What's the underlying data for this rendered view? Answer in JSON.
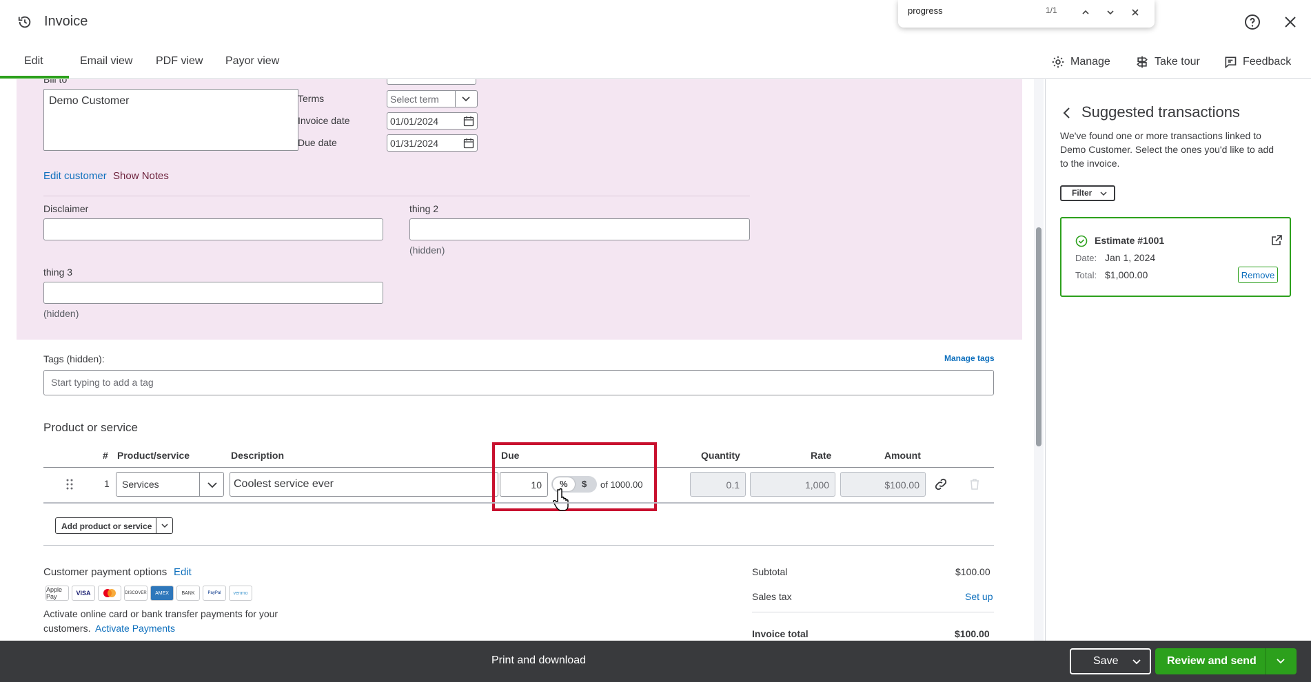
{
  "header": {
    "title": "Invoice"
  },
  "findbar": {
    "query": "progress",
    "count": "1/1"
  },
  "tabs": [
    {
      "label": "Edit"
    },
    {
      "label": "Email view"
    },
    {
      "label": "PDF view"
    },
    {
      "label": "Payor view"
    }
  ],
  "toolbar": {
    "manage": "Manage",
    "tour": "Take tour",
    "feedback": "Feedback"
  },
  "billing": {
    "bill_to_label": "Bill to",
    "customer_text": "Demo Customer",
    "edit_customer": "Edit customer",
    "show_notes": "Show Notes"
  },
  "terms": {
    "terms_label": "Terms",
    "terms_placeholder": "Select term",
    "invoice_date_label": "Invoice date",
    "invoice_date": "01/01/2024",
    "due_date_label": "Due date",
    "due_date": "01/31/2024"
  },
  "custom_fields": {
    "disclaimer_label": "Disclaimer",
    "thing2_label": "thing 2",
    "thing2_note": "(hidden)",
    "thing3_label": "thing 3",
    "thing3_note": "(hidden)"
  },
  "tags": {
    "label": "Tags (hidden):",
    "manage": "Manage tags",
    "placeholder": "Start typing to add a tag"
  },
  "products": {
    "heading": "Product or service",
    "columns": {
      "num": "#",
      "product": "Product/service",
      "description": "Description",
      "due": "Due",
      "quantity": "Quantity",
      "rate": "Rate",
      "amount": "Amount"
    },
    "row": {
      "num": "1",
      "product": "Services",
      "description": "Coolest service ever",
      "due_value": "10",
      "pct": "%",
      "dollar": "$",
      "of_total": "of 1000.00",
      "quantity": "0.1",
      "rate": "1,000",
      "amount": "$100.00"
    },
    "add_button": "Add product or service"
  },
  "payment": {
    "heading": "Customer payment options",
    "edit": "Edit",
    "methods": [
      "Apple Pay",
      "VISA",
      "Mastercard",
      "DISCOVER",
      "AMEX",
      "BANK",
      "PayPal",
      "venmo"
    ],
    "note_line1": "Activate online card or bank transfer payments for your",
    "note_line2": "customers.",
    "activate": "Activate Payments"
  },
  "totals": {
    "subtotal_label": "Subtotal",
    "subtotal": "$100.00",
    "tax_label": "Sales tax",
    "tax_action": "Set up",
    "total_label": "Invoice total",
    "total": "$100.00"
  },
  "panel": {
    "title": "Suggested transactions",
    "description_lines": [
      "We've found one or more transactions linked to",
      "Demo Customer. Select the ones you'd like to add",
      "to the invoice."
    ],
    "filter": "Filter",
    "card": {
      "title": "Estimate #1001",
      "date_label": "Date:",
      "date": "Jan 1, 2024",
      "total_label": "Total:",
      "total": "$1,000.00",
      "remove": "Remove"
    }
  },
  "bottom": {
    "print": "Print and download",
    "save": "Save",
    "review": "Review and send"
  },
  "colors": {
    "accent_green": "#2ca01c",
    "highlight_red": "#c8102e",
    "link_blue": "#0d6fbd",
    "pink_bg": "#f4e6f2",
    "bottom_bar": "#393a3d"
  }
}
